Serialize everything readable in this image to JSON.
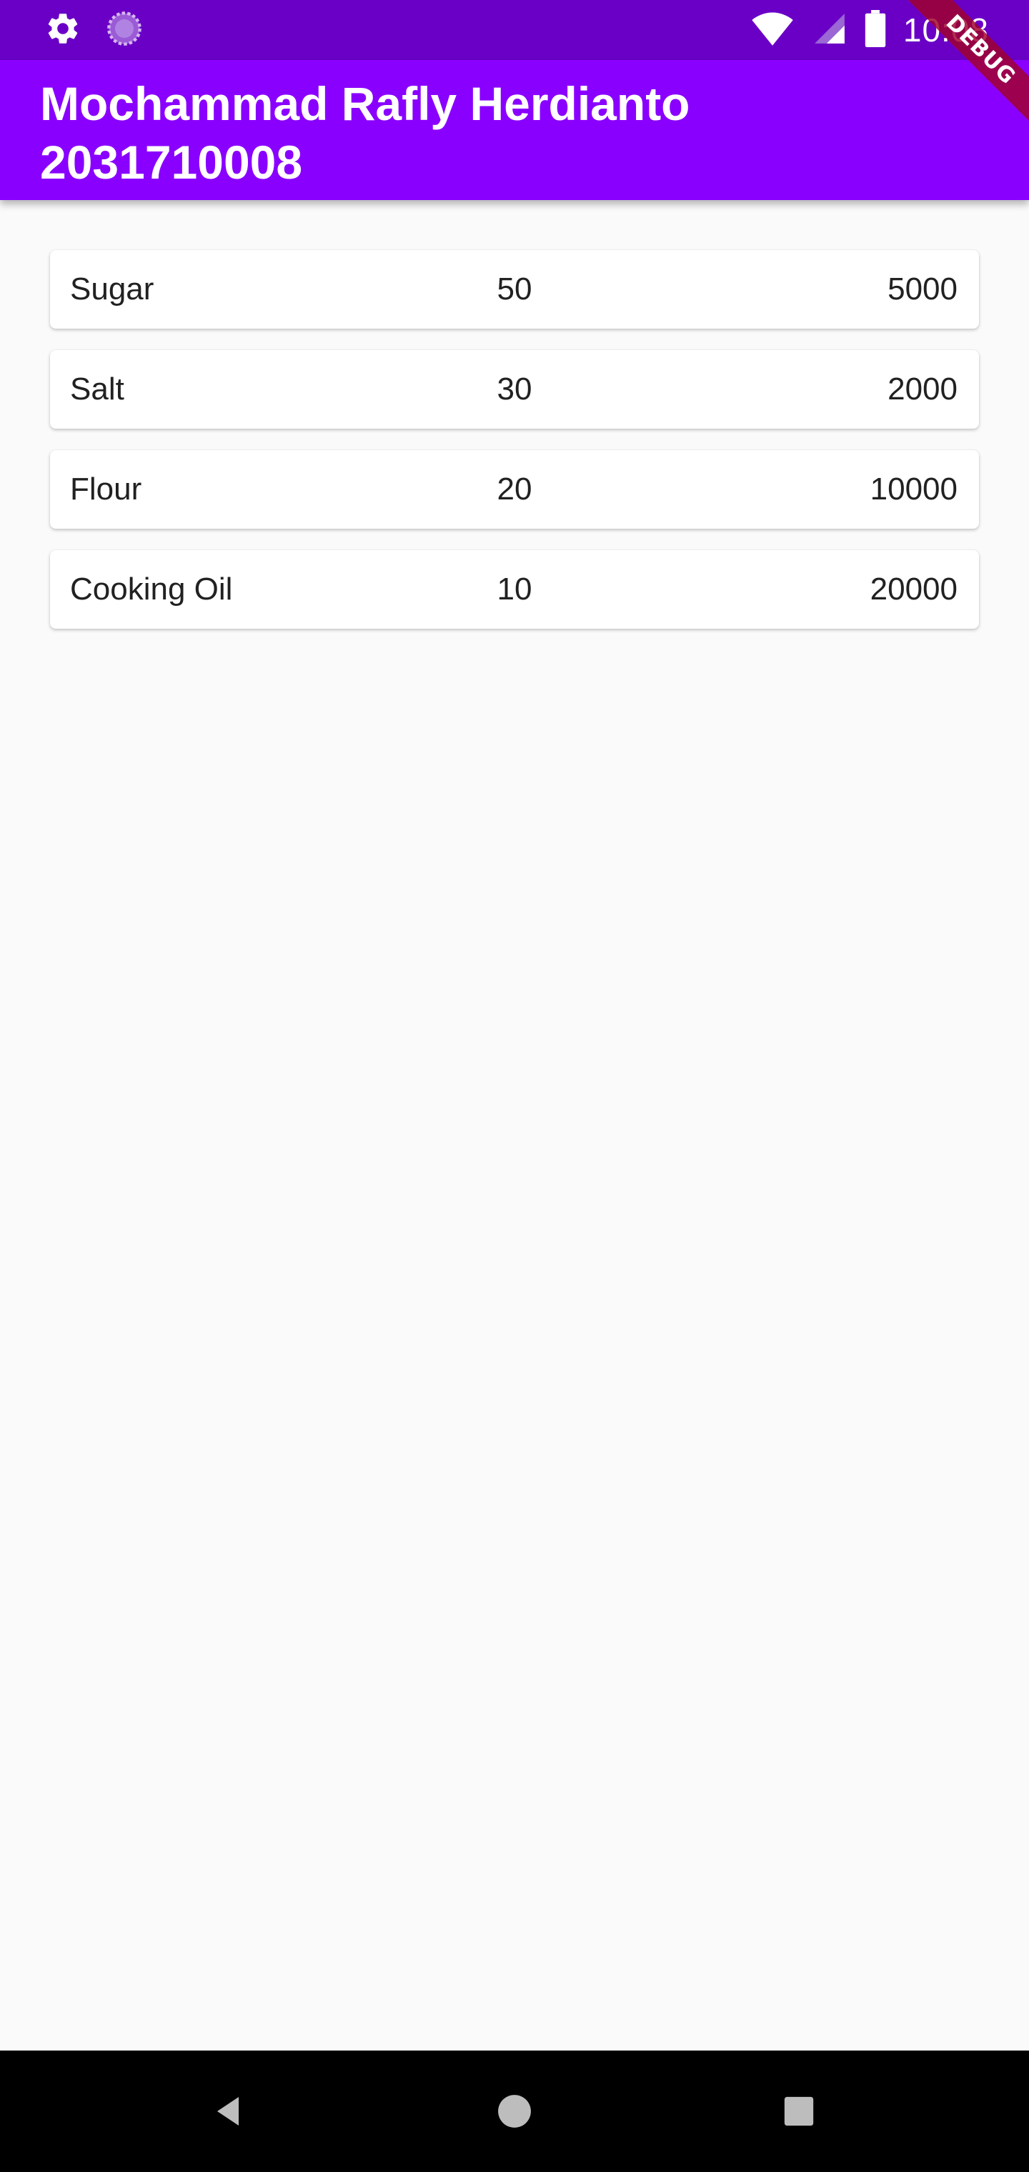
{
  "status_bar": {
    "time": "10:08",
    "icons": [
      "gear-icon",
      "loading-icon",
      "wifi-icon",
      "signal-icon",
      "battery-icon"
    ]
  },
  "app_bar": {
    "title": "Mochammad Rafly Herdianto\n2031710008",
    "color": "#8a00ff"
  },
  "debug_banner": "DEBUG",
  "items": [
    {
      "name": "Sugar",
      "qty": "50",
      "price": "5000"
    },
    {
      "name": "Salt",
      "qty": "30",
      "price": "2000"
    },
    {
      "name": "Flour",
      "qty": "20",
      "price": "10000"
    },
    {
      "name": "Cooking Oil",
      "qty": "10",
      "price": "20000"
    }
  ],
  "nav_bar": {
    "icons": [
      "back-icon",
      "home-icon",
      "recents-icon"
    ]
  }
}
